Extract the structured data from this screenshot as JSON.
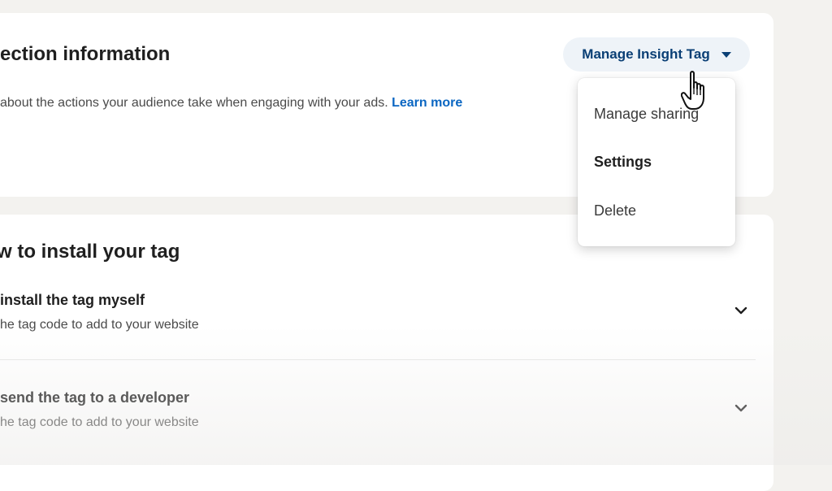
{
  "connection": {
    "title": "ection information",
    "description": "about the actions your audience take when engaging with your ads.",
    "learn_more": "Learn more"
  },
  "manage_button": {
    "label": "Manage Insight Tag",
    "icon": "caret-down-icon"
  },
  "dropdown": {
    "items": [
      {
        "label": "Manage sharing"
      },
      {
        "label": "Settings"
      },
      {
        "label": "Delete"
      }
    ]
  },
  "install": {
    "title": "w to install your tag",
    "options": [
      {
        "title": "install the tag myself",
        "subtitle": "he tag code to add to your website"
      },
      {
        "title": "send the tag to a developer",
        "subtitle": "he tag code to add to your website"
      }
    ]
  },
  "cursor": {
    "icon": "hand-pointer-icon"
  },
  "colors": {
    "link": "#0a66c2",
    "button_bg": "#eef3f8",
    "button_text": "#0a3f75",
    "page_bg": "#f3f2ef"
  }
}
